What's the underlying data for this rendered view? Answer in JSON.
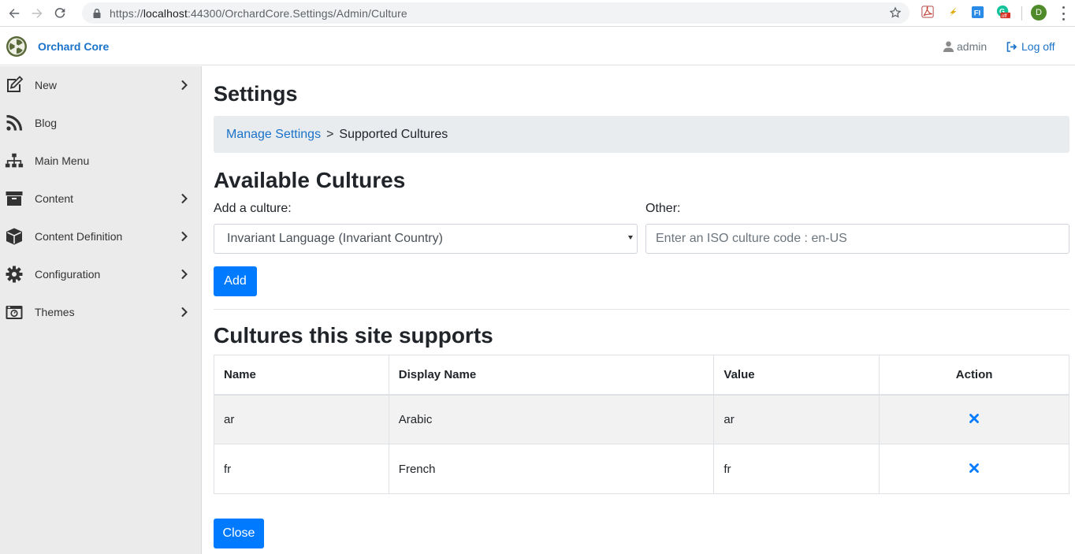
{
  "browser": {
    "url_scheme": "https://",
    "url_host": "localhost",
    "url_rest": ":44300/OrchardCore.Settings/Admin/Culture",
    "profile_initial": "D",
    "ext_badge": "off"
  },
  "navbar": {
    "brand": "Orchard Core",
    "user": "admin",
    "logoff": "Log off"
  },
  "sidebar": {
    "items": [
      {
        "label": "New",
        "icon": "new-icon",
        "chevron": true
      },
      {
        "label": "Blog",
        "icon": "rss-icon",
        "chevron": false
      },
      {
        "label": "Main Menu",
        "icon": "sitemap-icon",
        "chevron": false
      },
      {
        "label": "Content",
        "icon": "archive-icon",
        "chevron": true
      },
      {
        "label": "Content Definition",
        "icon": "cube-icon",
        "chevron": true
      },
      {
        "label": "Configuration",
        "icon": "cog-icon",
        "chevron": true
      },
      {
        "label": "Themes",
        "icon": "camera-icon",
        "chevron": true
      }
    ]
  },
  "page": {
    "title": "Settings",
    "breadcrumb_link": "Manage Settings",
    "breadcrumb_sep": ">",
    "breadcrumb_current": "Supported Cultures",
    "available_heading": "Available Cultures",
    "add_culture_label": "Add a culture:",
    "other_label": "Other:",
    "select_value": "Invariant Language (Invariant Country)",
    "other_placeholder": "Enter an ISO culture code : en-US",
    "add_button": "Add",
    "supports_heading": "Cultures this site supports",
    "close_button": "Close"
  },
  "table": {
    "headers": [
      "Name",
      "Display Name",
      "Value",
      "Action"
    ],
    "rows": [
      {
        "name": "ar",
        "display": "Arabic",
        "value": "ar"
      },
      {
        "name": "fr",
        "display": "French",
        "value": "fr"
      }
    ]
  },
  "colors": {
    "primary": "#007bff",
    "link": "#1a73c9",
    "sidebar_bg": "#ebebeb"
  }
}
